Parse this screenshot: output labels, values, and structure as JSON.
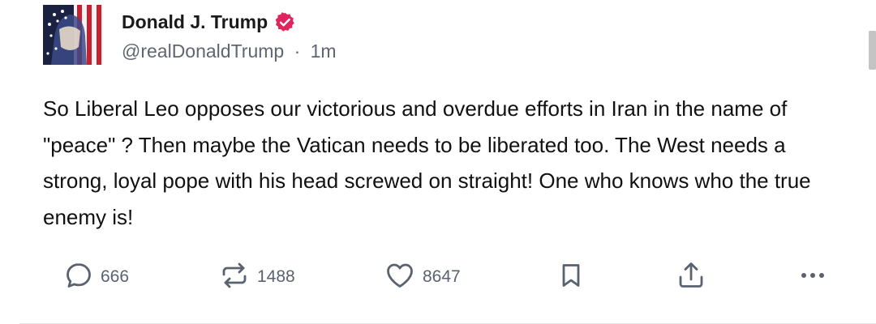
{
  "post": {
    "author": {
      "name": "Donald J. Trump",
      "handle": "@realDonaldTrump",
      "separator": "·",
      "time": "1m"
    },
    "text": "So Liberal Leo opposes our victorious and overdue efforts in Iran in the name of \"peace\" ? Then maybe the Vatican needs to be liberated too. The West needs a strong, loyal pope with his head screwed on straight! One who knows who the true enemy is!",
    "actions": {
      "replies": "666",
      "reposts": "1488",
      "likes": "8647"
    }
  },
  "colors": {
    "verified_badge": "#e0245e",
    "icon_gray": "#5a6270",
    "text": "#111111"
  },
  "icons": {
    "reply": "speech-bubble",
    "repost": "repost-arrows",
    "like": "heart-outline",
    "bookmark": "bookmark-outline",
    "share": "share-up-arrow",
    "more": "ellipsis"
  }
}
